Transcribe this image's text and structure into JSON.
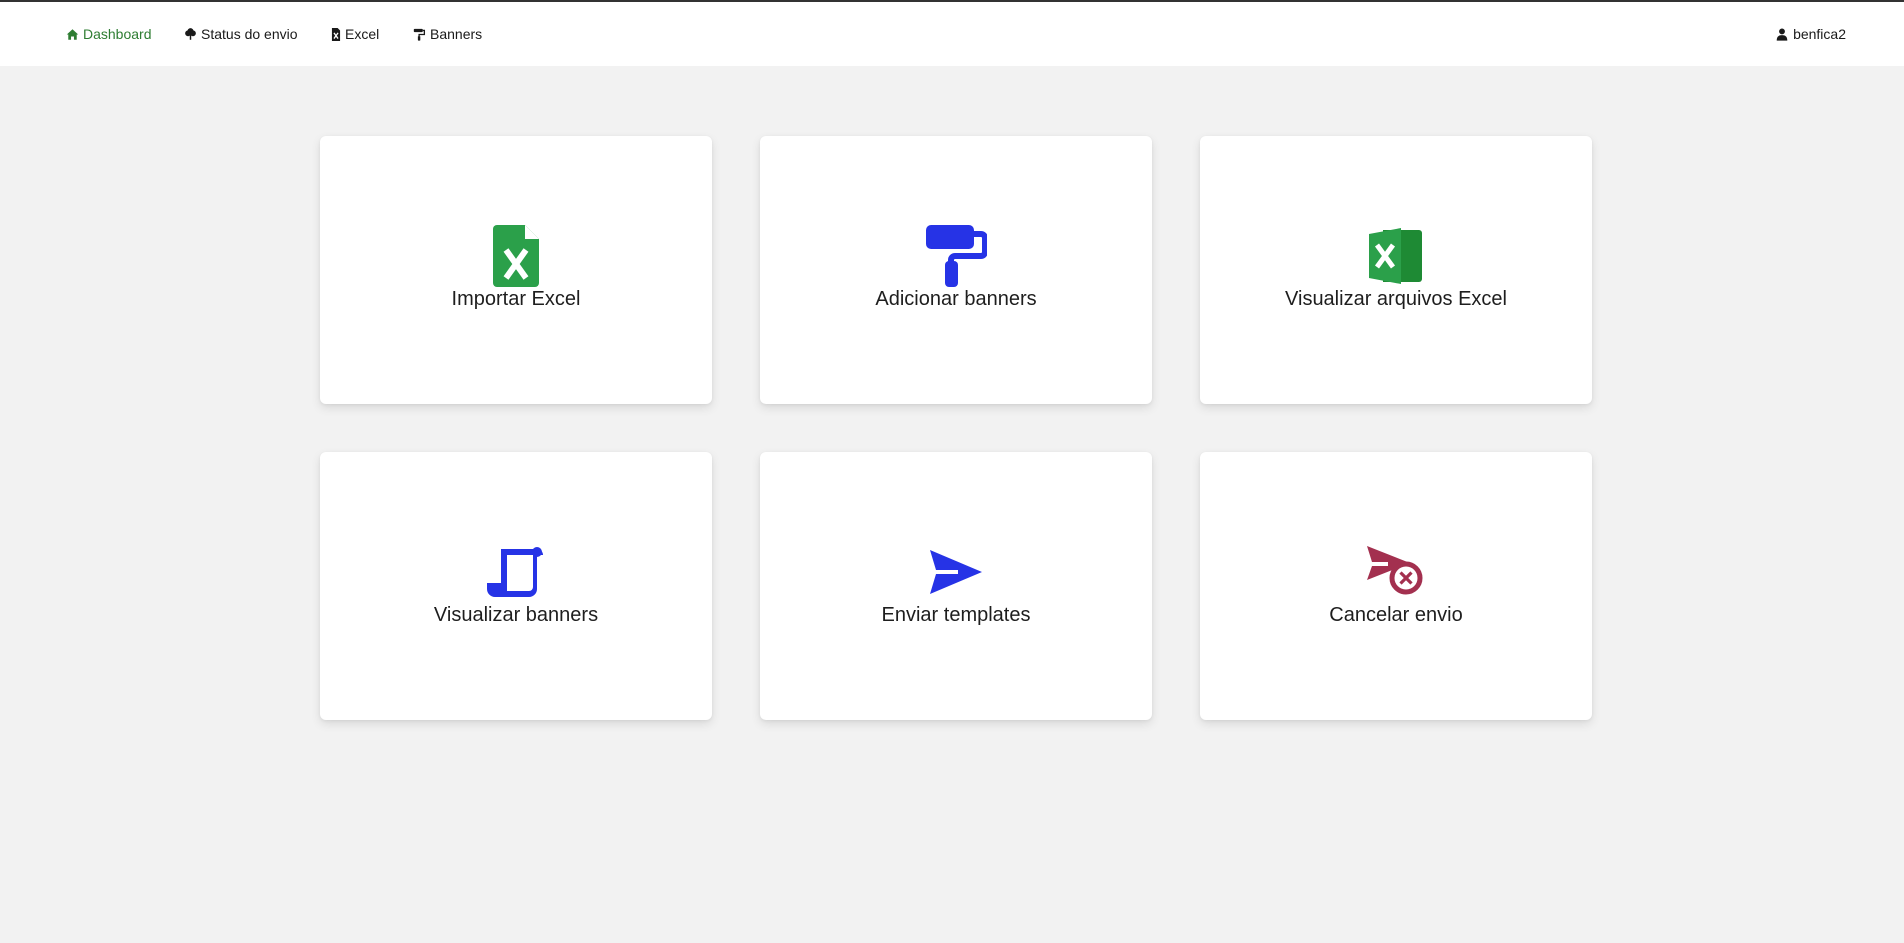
{
  "navbar": {
    "items": [
      {
        "label": "Dashboard",
        "icon": "home-icon",
        "active": true
      },
      {
        "label": "Status do envio",
        "icon": "tree-icon",
        "active": false
      },
      {
        "label": "Excel",
        "icon": "excel-file-icon",
        "active": false
      },
      {
        "label": "Banners",
        "icon": "paint-roller-icon",
        "active": false
      }
    ],
    "user": {
      "label": "benfica2",
      "icon": "user-icon"
    }
  },
  "colors": {
    "active_nav": "#2e7d32",
    "excel_green": "#2ba04a",
    "excel_dark_green": "#1e8a34",
    "blue": "#2633e6",
    "cancel": "#a3304f"
  },
  "cards": [
    {
      "label": "Importar Excel",
      "icon": "file-excel-icon"
    },
    {
      "label": "Adicionar banners",
      "icon": "paint-roller-icon"
    },
    {
      "label": "Visualizar arquivos Excel",
      "icon": "microsoft-excel-icon"
    },
    {
      "label": "Visualizar banners",
      "icon": "scroll-icon"
    },
    {
      "label": "Enviar templates",
      "icon": "send-icon"
    },
    {
      "label": "Cancelar envio",
      "icon": "cancel-send-icon"
    }
  ]
}
